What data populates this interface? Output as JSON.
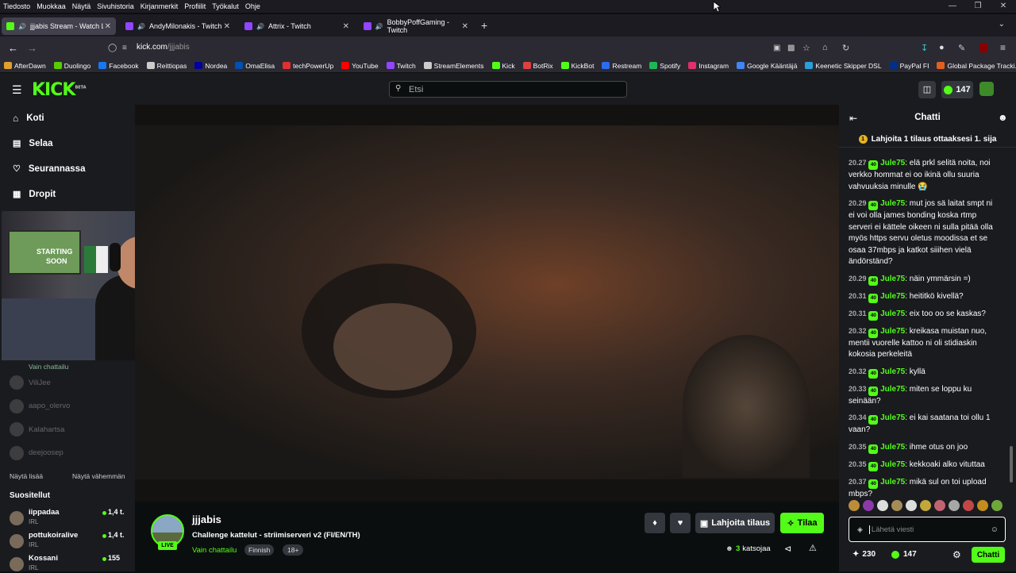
{
  "menubar": [
    "Tiedosto",
    "Muokkaa",
    "Näytä",
    "Sivuhistoria",
    "Kirjanmerkit",
    "Profiilit",
    "Työkalut",
    "Ohje"
  ],
  "tabs": [
    {
      "label": "jjjabis Stream - Watch Live",
      "icon": "kick-favicon",
      "color": "#53fc18"
    },
    {
      "label": "AndyMilonakis - Twitch",
      "icon": "twitch-favicon",
      "color": "#9146ff"
    },
    {
      "label": "Attrix - Twitch",
      "icon": "twitch-favicon",
      "color": "#9146ff"
    },
    {
      "label": "BobbyPoffGaming - Twitch",
      "icon": "twitch-favicon",
      "color": "#9146ff"
    }
  ],
  "url": {
    "host": "kick.com",
    "path": "/jjjabis"
  },
  "bookmarks": [
    {
      "label": "AfterDawn",
      "color": "#e0a030"
    },
    {
      "label": "Duolingo",
      "color": "#58cc02"
    },
    {
      "label": "Facebook",
      "color": "#1877f2"
    },
    {
      "label": "Reittiopas",
      "color": "#cccccc"
    },
    {
      "label": "Nordea",
      "color": "#0000a0"
    },
    {
      "label": "OmaElisa",
      "color": "#0050b4"
    },
    {
      "label": "techPowerUp",
      "color": "#e03030"
    },
    {
      "label": "YouTube",
      "color": "#ff0000"
    },
    {
      "label": "Twitch",
      "color": "#9146ff"
    },
    {
      "label": "StreamElements",
      "color": "#cccccc"
    },
    {
      "label": "Kick",
      "color": "#53fc18"
    },
    {
      "label": "BotRix",
      "color": "#e04040"
    },
    {
      "label": "KickBot",
      "color": "#53fc18"
    },
    {
      "label": "Restream",
      "color": "#2b6cf0"
    },
    {
      "label": "Spotify",
      "color": "#1db954"
    },
    {
      "label": "Instagram",
      "color": "#e1306c"
    },
    {
      "label": "Google Kääntäjä",
      "color": "#4285f4"
    },
    {
      "label": "Keenetic Skipper DSL",
      "color": "#2aa0d8"
    },
    {
      "label": "PayPal FI",
      "color": "#003087"
    },
    {
      "label": "Global Package Tracki...",
      "color": "#e06020"
    }
  ],
  "site": {
    "logo": "KICK",
    "logo_beta": "BETA",
    "search_placeholder": "Etsi",
    "balance": "147"
  },
  "sidebar": {
    "nav": [
      {
        "label": "Koti",
        "icon": "home-icon"
      },
      {
        "label": "Selaa",
        "icon": "browse-icon"
      },
      {
        "label": "Seurannassa",
        "icon": "heart-icon"
      },
      {
        "label": "Dropit",
        "icon": "drops-icon"
      }
    ],
    "followed_status": "Vain chattailu",
    "followed": [
      "ViliJee",
      "aapo_olervo",
      "Kalahartsa",
      "deejoosep"
    ],
    "show_more": "Näytä lisää",
    "show_less": "Näytä vähemmän",
    "recommended_title": "Suositellut",
    "recommended": [
      {
        "name": "iippadaa",
        "category": "IRL",
        "viewers": "1,4 t."
      },
      {
        "name": "pottukoiralive",
        "category": "IRL",
        "viewers": "1,4 t."
      },
      {
        "name": "Kossani",
        "category": "IRL",
        "viewers": "155"
      }
    ]
  },
  "webcam": {
    "sign_line1": "STARTING",
    "sign_line2": "SOON"
  },
  "stream": {
    "channel": "jjjabis",
    "live_label": "LIVE",
    "title": "Challenge kattelut - striimiserveri v2 (FI/EN/TH)",
    "category": "Vain chattailu",
    "tags": [
      "Finnish",
      "18+"
    ],
    "gift_label": "Lahjoita tilaus",
    "subscribe_label": "Tilaa",
    "viewers_count": "3",
    "viewers_label": "katsojaa"
  },
  "chat": {
    "title": "Chatti",
    "pinned": "Lahjoita 1 tilaus ottaaksesi 1. sija",
    "pinned_rank": "1",
    "messages": [
      {
        "time": "20.27",
        "badge": "40",
        "user": "Jule75",
        "text": "elä prkl selitä noita, noi verkko hommat ei oo ikinä ollu suuria vahvuuksia minulle 😭"
      },
      {
        "time": "20.29",
        "badge": "40",
        "user": "Jule75",
        "text": "mut jos sä laitat smpt ni ei voi olla james bonding koska rtmp serveri ei kättele oikeen ni sulla pitää olla myös https servu oletus moodissa et se osaa 37mbps ja katkot siiihen vielä ändörständ?"
      },
      {
        "time": "20.29",
        "badge": "40",
        "user": "Jule75",
        "text": "näin ymmärsin =)"
      },
      {
        "time": "20.31",
        "badge": "40",
        "user": "Jule75",
        "text": "heititkö kivellä?"
      },
      {
        "time": "20.31",
        "badge": "40",
        "user": "Jule75",
        "text": "eix too oo se kaskas?"
      },
      {
        "time": "20.32",
        "badge": "40",
        "user": "Jule75",
        "text": "kreikasa muistan nuo, mentii vuorelle kattoo ni oli stidiaskin kokosia perkeleitä"
      },
      {
        "time": "20.32",
        "badge": "40",
        "user": "Jule75",
        "text": "kyllä"
      },
      {
        "time": "20.33",
        "badge": "40",
        "user": "Jule75",
        "text": "miten se loppu ku seinään?"
      },
      {
        "time": "20.34",
        "badge": "40",
        "user": "Jule75",
        "text": "ei kai saatana toi ollu 1 vaan?"
      },
      {
        "time": "20.35",
        "badge": "40",
        "user": "Jule75",
        "text": "ihme otus on joo"
      },
      {
        "time": "20.35",
        "badge": "40",
        "user": "Jule75",
        "text": "kekkoaki alko vituttaa"
      },
      {
        "time": "20.37",
        "badge": "40",
        "user": "Jule75",
        "text": "mikä sul on toi upload mbps?"
      }
    ],
    "input_placeholder": "Lähetä viesti",
    "points": "230",
    "kicks": "147",
    "send_label": "Chatti"
  }
}
